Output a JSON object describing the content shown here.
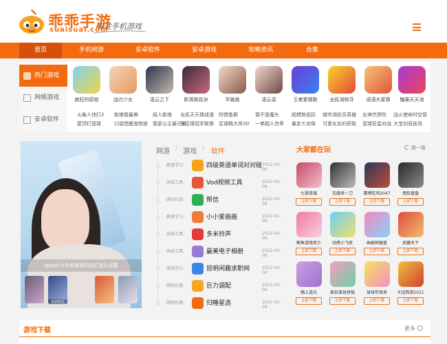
{
  "site": {
    "title": "乖乖手游",
    "domain_text": "suaisuai.com",
    "slogan": "专注手机游戏"
  },
  "nav": [
    "首页",
    "手机网游",
    "安卓软件",
    "安卓游戏",
    "攻略资讯",
    "合集"
  ],
  "hot": {
    "tabs": [
      "热门游戏",
      "网络游戏",
      "安卓软件"
    ],
    "games": [
      "疯狂的原始",
      "战刃少女",
      "凌云之下",
      "影落桃花诀",
      "华裳曲",
      "凌云谣",
      "王者爱猜歌",
      "全民消除寻",
      "成语大家猜",
      "糖果天天消"
    ],
    "links": [
      [
        "火柴人快打2",
        "屋顶打篮球"
      ],
      [
        "新娘我最美",
        "口袋觉醒宠物放"
      ],
      [
        "纸人新娘",
        "我家公主最可爱"
      ],
      [
        "全民天天猜成语",
        "头足球冠军联赛"
      ],
      [
        "狩猎鱼群",
        "足球踢大师3D"
      ],
      [
        "我不是魔头",
        "一拳超人世界"
      ],
      [
        "超燃剪纸扣",
        "暴走七龙珠"
      ],
      [
        "城市消防员英雄",
        "可爱女友的获取"
      ],
      [
        "女神杰贺吹",
        "篮球狂星对战"
      ],
      [
        "战火使命时空冒",
        "大宝剑竞技场"
      ]
    ]
  },
  "banner": {
    "caption": "oppok7x手机来电闪光灯怎么设置",
    "thumbs": [
      "",
      "天启剑主",
      "",
      ""
    ]
  },
  "list": {
    "tabs": [
      "网游",
      "游戏",
      "软件"
    ],
    "items": [
      {
        "cat": "-教育学习-",
        "name": "四级英语单词对对碰",
        "date": "2022-04-06",
        "color": "#f6a51a"
      },
      {
        "cat": "-系统工具-",
        "name": "Vod视频工具",
        "date": "2022-04-06",
        "color": "#e9553a"
      },
      {
        "cat": "-通讯社交-",
        "name": "帮信",
        "date": "2022-04-06",
        "color": "#2dae57"
      },
      {
        "cat": "-教育学习-",
        "name": "小小爱画画",
        "date": "2022-04-06",
        "color": "#f07a3a"
      },
      {
        "cat": "-系统工具-",
        "name": "多米铃声",
        "date": "2022-04-06",
        "color": "#e23b3b"
      },
      {
        "cat": "-系统工具-",
        "name": "最美电子相册",
        "date": "2022-04-06",
        "color": "#9a7ad8"
      },
      {
        "cat": "-商务办公-",
        "name": "昆明闲趣求职网",
        "date": "2022-04-06",
        "color": "#3a86e8"
      },
      {
        "cat": "-购物优惠-",
        "name": "巨力调配",
        "date": "2022-04-06",
        "color": "#f5a623"
      },
      {
        "cat": "-购物优惠-",
        "name": "归睡星选",
        "date": "2022-04-06",
        "color": "#f36b10"
      }
    ]
  },
  "right": {
    "title": "大家都在玩",
    "refresh": "换一换",
    "download_label": "立即下载",
    "games": [
      "九霄琉璃",
      "见缝来一刀",
      "赛博吃鸡2047",
      "墙枝盘盘",
      "鲵鱼游戏死亡",
      "动感小飞侠",
      "画廊割据盘",
      "武藏天下",
      "踏上逃兵",
      "疯狂滚球拼装",
      "球球你快来",
      "大话西游2021"
    ]
  },
  "bottom": {
    "title": "游戏下载",
    "more": "更多"
  },
  "colors": {
    "accent": "#f36b10",
    "nav_active": "#d5500a"
  }
}
